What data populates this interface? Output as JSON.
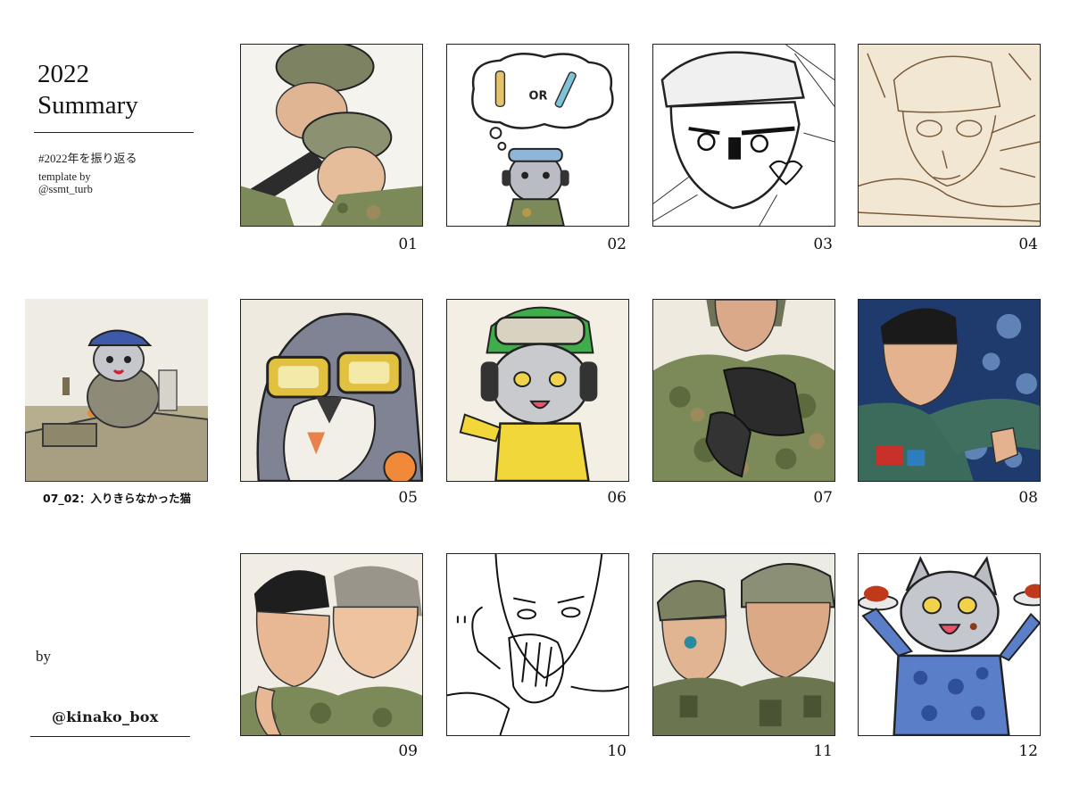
{
  "header": {
    "title_line1": "2022",
    "title_line2": "Summary",
    "hashtag": "#2022年を振り返る",
    "template_line1": "template by",
    "template_line2": "@ssmt_turb"
  },
  "footer": {
    "by_label": "by",
    "author_handle": "@kinako_box"
  },
  "extra": {
    "caption": "07_02：入りきらなかった猫"
  },
  "tiles": [
    {
      "number": "01"
    },
    {
      "number": "02"
    },
    {
      "number": "03"
    },
    {
      "number": "04"
    },
    {
      "number": "05"
    },
    {
      "number": "06"
    },
    {
      "number": "07"
    },
    {
      "number": "08"
    },
    {
      "number": "09"
    },
    {
      "number": "10"
    },
    {
      "number": "11"
    },
    {
      "number": "12"
    }
  ],
  "thought_bubble_text": "OR",
  "colors": {
    "border": "#222222",
    "camo_green": "#7c8a5a",
    "cat_grey": "#b9bcc2",
    "yellow": "#f1d73a",
    "blue_uniform": "#5b7ec8"
  }
}
